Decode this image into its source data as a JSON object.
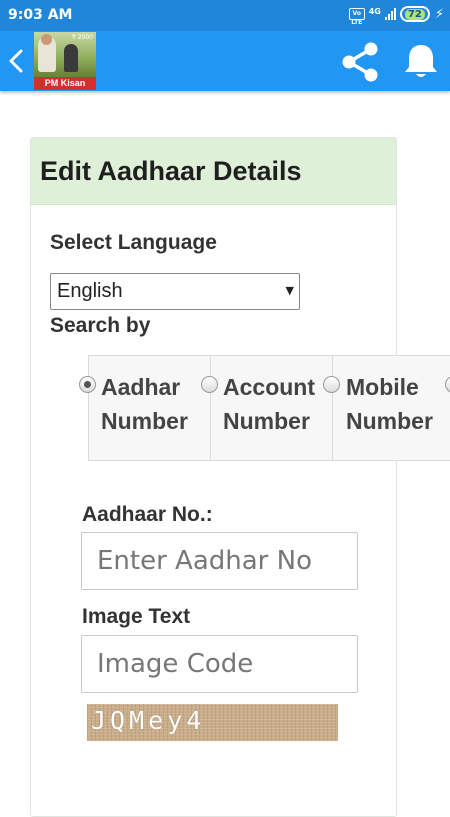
{
  "status_bar": {
    "time": "9:03 AM",
    "volte": "Vo LTE",
    "network": "4G",
    "battery": "72"
  },
  "app_bar": {
    "logo_label": "PM Kisan",
    "logo_amount": "₹ 2000"
  },
  "card": {
    "title": "Edit Aadhaar Details"
  },
  "form": {
    "language_label": "Select Language",
    "language_value": "English",
    "search_by_label": "Search by",
    "search_options": [
      {
        "line1": "Aadhar",
        "line2": "Number",
        "selected": true
      },
      {
        "line1": "Account",
        "line2": "Number",
        "selected": false
      },
      {
        "line1": "Mobile",
        "line2": "Number",
        "selected": false
      }
    ],
    "aadhaar_label": "Aadhaar No.:",
    "aadhaar_placeholder": "Enter Aadhar No",
    "image_text_label": "Image Text",
    "image_code_placeholder": "Image Code",
    "captcha_text": "JQMey4"
  },
  "colors": {
    "status_bar": "#1f86da",
    "app_bar": "#2196f3",
    "card_header": "#dff0d8",
    "logo_label": "#d32f2f"
  },
  "icons": [
    "back-arrow-icon",
    "share-icon",
    "bell-icon",
    "signal-icon",
    "battery-icon",
    "charging-icon"
  ]
}
